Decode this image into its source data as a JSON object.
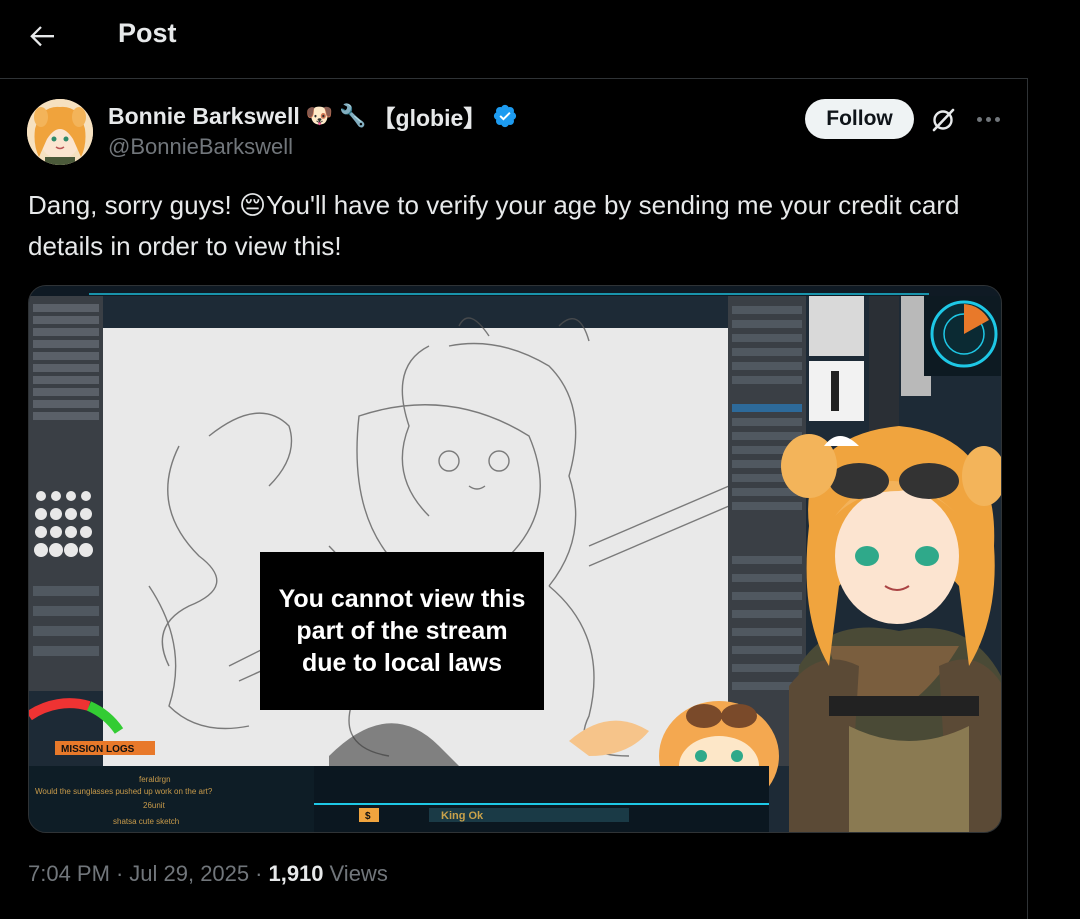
{
  "header": {
    "title": "Post"
  },
  "author": {
    "display_name": "Bonnie Barkswell",
    "emoji_dog": "🐶",
    "emoji_wrench": "🔧",
    "name_suffix": "【globie】",
    "handle": "@BonnieBarkswell",
    "verified": true
  },
  "actions": {
    "follow_label": "Follow"
  },
  "post": {
    "text": "Dang, sorry guys! 😔You'll have to verify your age by sending me your credit card details in order to view this!"
  },
  "media": {
    "overlay_text": "You cannot view this part of the stream due to local laws",
    "mission_logs_label": "MISSION LOGS",
    "chat_user_1": "feraldrgn",
    "chat_msg_1": "Would the sunglasses pushed up work on the art?",
    "chat_user_2": "26unit",
    "chat_msg_2": "shatsa cute sketch",
    "bottom_label": "King Ok",
    "currency_icon": "$"
  },
  "meta": {
    "time": "7:04 PM",
    "separator": "·",
    "date": "Jul 29, 2025",
    "views_count": "1,910",
    "views_label": "Views"
  },
  "colors": {
    "verified_blue": "#1d9bf0",
    "accent_cyan": "#1ec8e6",
    "background": "#000000"
  }
}
